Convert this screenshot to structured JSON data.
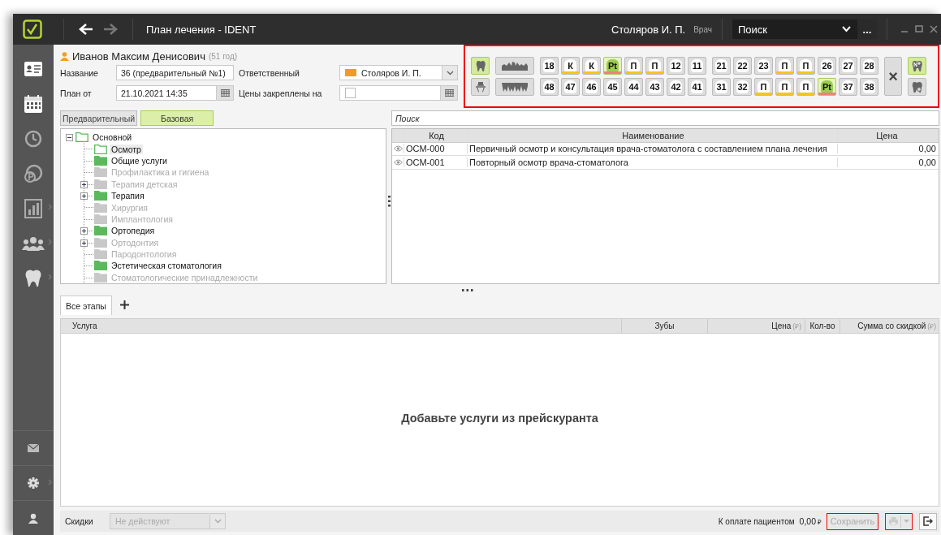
{
  "titlebar": {
    "title": "План лечения  -  IDENT",
    "user": "Столяров И. П.",
    "role": "Врач",
    "search": {
      "value": "Поиск"
    },
    "more": "..."
  },
  "sidebar": {
    "items": [
      {
        "kind": "card",
        "submenu": false
      },
      {
        "kind": "calendar",
        "submenu": false
      },
      {
        "kind": "history",
        "submenu": false
      },
      {
        "kind": "coin",
        "submenu": false
      },
      {
        "kind": "chart",
        "submenu": true
      },
      {
        "kind": "people",
        "submenu": true
      },
      {
        "kind": "tooth",
        "submenu": true
      }
    ],
    "bottom": [
      {
        "kind": "mail",
        "submenu": false
      },
      {
        "kind": "gear",
        "submenu": true
      },
      {
        "kind": "user",
        "submenu": false
      }
    ]
  },
  "patient": {
    "name": "Иванов Максим Денисович",
    "age": "(51 год)"
  },
  "fields": {
    "name_label": "Название",
    "name_value": "36 (предварительный №1)",
    "date_label": "План от",
    "date_value": "21.10.2021 14:35",
    "resp_label": "Ответственный",
    "responsible": {
      "value": "Столяров И. П.",
      "color": "#ef9a2c"
    },
    "fixed_label": "Цены закреплены на",
    "fixed_checked": false
  },
  "dental_chart": {
    "view_buttons": [
      {
        "kind": "single",
        "selected": true
      },
      {
        "kind": "implant",
        "selected": false
      }
    ],
    "jaw_buttons": [
      {
        "kind": "upper"
      },
      {
        "kind": "lower"
      }
    ],
    "upper_left": [
      {
        "label": "18"
      },
      {
        "label": "К",
        "color": "#f5c518"
      },
      {
        "label": "К",
        "color": "#f5c518"
      },
      {
        "label": "Pt",
        "color": "#f08080",
        "highlighted": true
      },
      {
        "label": "П",
        "color": "#f5c518"
      },
      {
        "label": "П",
        "color": "#f5c518"
      },
      {
        "label": "12"
      },
      {
        "label": "11"
      }
    ],
    "upper_right": [
      {
        "label": "21"
      },
      {
        "label": "22"
      },
      {
        "label": "23"
      },
      {
        "label": "П",
        "color": "#f5c518"
      },
      {
        "label": "П",
        "color": "#f5c518"
      },
      {
        "label": "26"
      },
      {
        "label": "27"
      },
      {
        "label": "28"
      }
    ],
    "lower_left": [
      {
        "label": "48"
      },
      {
        "label": "47"
      },
      {
        "label": "46"
      },
      {
        "label": "45"
      },
      {
        "label": "44"
      },
      {
        "label": "43"
      },
      {
        "label": "42"
      },
      {
        "label": "41"
      }
    ],
    "lower_right": [
      {
        "label": "31"
      },
      {
        "label": "32"
      },
      {
        "label": "П",
        "color": "#f5c518"
      },
      {
        "label": "П",
        "color": "#f5c518"
      },
      {
        "label": "П",
        "color": "#f5c518"
      },
      {
        "label": "Pt",
        "color": "#f08080",
        "highlighted": true
      },
      {
        "label": "37"
      },
      {
        "label": "38"
      }
    ],
    "clear": "×",
    "right_buttons": [
      {
        "kind": "numbered",
        "selected": true
      },
      {
        "kind": "search",
        "selected": false
      }
    ]
  },
  "price_tabs": [
    {
      "label": "Предварительный",
      "selected": false
    },
    {
      "label": "Базовая",
      "selected": true
    }
  ],
  "tree": {
    "label": "Основной",
    "expanded": true,
    "children": [
      {
        "label": "Осмотр",
        "active": true,
        "selected": true
      },
      {
        "label": "Общие услуги",
        "active": true,
        "selected": false
      },
      {
        "label": "Профилактика и гигиена",
        "active": false,
        "selected": false
      },
      {
        "label": "Терапия детская",
        "active": false,
        "selected": false,
        "expanded": false
      },
      {
        "label": "Терапия",
        "active": true,
        "selected": false,
        "expanded": false
      },
      {
        "label": "Хирургия",
        "active": false,
        "selected": false
      },
      {
        "label": "Имплантология",
        "active": false,
        "selected": false
      },
      {
        "label": "Ортопедия",
        "active": true,
        "selected": false,
        "expanded": false
      },
      {
        "label": "Ортодонтия",
        "active": false,
        "selected": false,
        "expanded": false
      },
      {
        "label": "Пародонтология",
        "active": false,
        "selected": false
      },
      {
        "label": "Эстетическая стоматология",
        "active": true,
        "selected": false
      },
      {
        "label": "Стоматологические принадлежности",
        "active": false,
        "selected": false
      }
    ]
  },
  "price_search": {
    "placeholder": "Поиск"
  },
  "price_table": {
    "columns": [
      "Код",
      "Наименование",
      "Цена"
    ],
    "rows": [
      {
        "code": "ОСМ-000",
        "name": "Первичный осмотр и консультация врача-стоматолога с составлением плана лечения",
        "price": "0,00"
      },
      {
        "code": "ОСМ-001",
        "name": "Повторный осмотр врача-стоматолога",
        "price": "0,00"
      }
    ]
  },
  "stage_tabs": [
    {
      "label": "Все этапы",
      "selected": true
    }
  ],
  "plan_table": {
    "columns": [
      {
        "label": "Услуга"
      },
      {
        "label": "Зубы"
      },
      {
        "label": "Цена",
        "unit": "(₽)"
      },
      {
        "label": "Кол-во"
      },
      {
        "label": "Сумма со скидкой",
        "unit": "(₽)"
      }
    ],
    "empty": "Добавьте услуги из прейскуранта"
  },
  "footer": {
    "discount_label": "Скидки",
    "discount_value": "Не действуют",
    "discount_disabled": true,
    "total_label": "К оплате пациентом",
    "total_value": "0,00",
    "currency": "₽",
    "save": "Сохранить",
    "save_disabled": true
  }
}
